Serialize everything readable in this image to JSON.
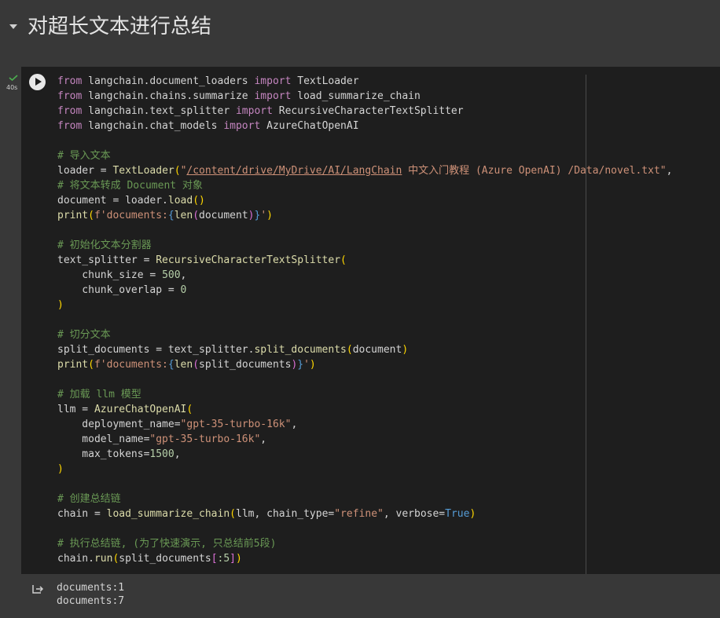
{
  "section": {
    "title": "对超长文本进行总结"
  },
  "cell": {
    "exec_time": "40s"
  },
  "code": {
    "l1": {
      "a": "from",
      "b": " langchain.document_loaders ",
      "c": "import",
      "d": " TextLoader"
    },
    "l2": {
      "a": "from",
      "b": " langchain.chains.summarize ",
      "c": "import",
      "d": " load_summarize_chain"
    },
    "l3": {
      "a": "from",
      "b": " langchain.text_splitter ",
      "c": "import",
      "d": " RecursiveCharacterTextSplitter"
    },
    "l4": {
      "a": "from",
      "b": " langchain.chat_models ",
      "c": "import",
      "d": " AzureChatOpenAI"
    },
    "l6": "# 导入文本",
    "l7": {
      "a": "loader = ",
      "b": "TextLoader",
      "c": "(",
      "d": "\"",
      "e": "/content/drive/MyDrive/AI/LangChain",
      "f": " 中文入门教程 (Azure OpenAI) /Data/novel.txt\"",
      "g": ","
    },
    "l8": "# 将文本转成 Document 对象",
    "l9": {
      "a": "document = loader.",
      "b": "load",
      "c": "(",
      "d": ")"
    },
    "l10": {
      "a": "print",
      "b": "(",
      "c": "f'documents:",
      "d": "{",
      "e": "len",
      "f": "(",
      "g": "document",
      "h": ")",
      "i": "}",
      "j": "'",
      "k": ")"
    },
    "l12": "# 初始化文本分割器",
    "l13": {
      "a": "text_splitter = ",
      "b": "RecursiveCharacterTextSplitter",
      "c": "("
    },
    "l14": {
      "a": "    chunk_size = ",
      "b": "500",
      "c": ","
    },
    "l15": {
      "a": "    chunk_overlap = ",
      "b": "0"
    },
    "l16": ")",
    "l18": "# 切分文本",
    "l19": {
      "a": "split_documents = text_splitter.",
      "b": "split_documents",
      "c": "(",
      "d": "document",
      "e": ")"
    },
    "l20": {
      "a": "print",
      "b": "(",
      "c": "f'documents:",
      "d": "{",
      "e": "len",
      "f": "(",
      "g": "split_documents",
      "h": ")",
      "i": "}",
      "j": "'",
      "k": ")"
    },
    "l22": "# 加载 llm 模型",
    "l23": {
      "a": "llm = ",
      "b": "AzureChatOpenAI",
      "c": "("
    },
    "l24": {
      "a": "    deployment_name=",
      "b": "\"gpt-35-turbo-16k\"",
      "c": ","
    },
    "l25": {
      "a": "    model_name=",
      "b": "\"gpt-35-turbo-16k\"",
      "c": ","
    },
    "l26": {
      "a": "    max_tokens=",
      "b": "1500",
      "c": ","
    },
    "l27": ")",
    "l29": "# 创建总结链",
    "l30": {
      "a": "chain = ",
      "b": "load_summarize_chain",
      "c": "(",
      "d": "llm, chain_type=",
      "e": "\"refine\"",
      "f": ", verbose=",
      "g": "True",
      "h": ")"
    },
    "l32": "# 执行总结链, (为了快速演示, 只总结前5段)",
    "l33": {
      "a": "chain.",
      "b": "run",
      "c": "(",
      "d": "split_documents",
      "e": "[",
      "f": ":5",
      "g": "]",
      "h": ")"
    }
  },
  "output": {
    "line1": "documents:1",
    "line2": "documents:7"
  }
}
